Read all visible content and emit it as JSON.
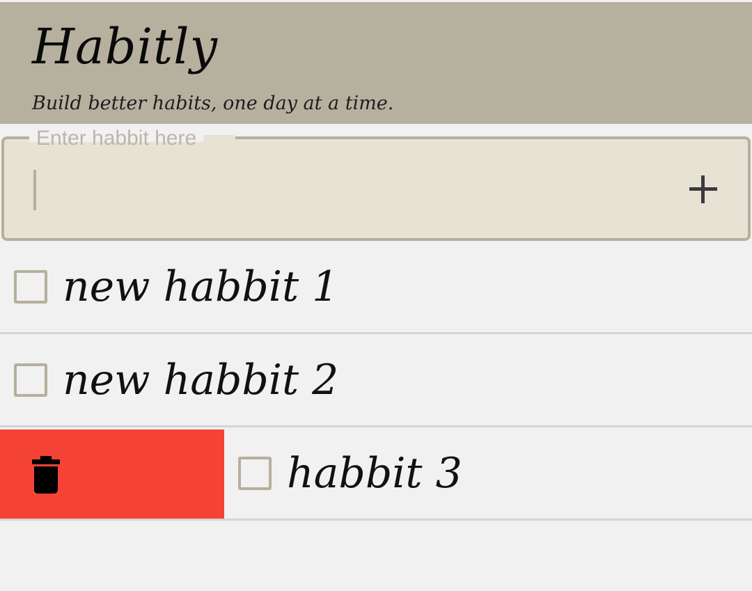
{
  "header": {
    "title": "Habitly",
    "subtitle": "Build better habits, one day at a time."
  },
  "input": {
    "label": "Enter habbit here",
    "value": "",
    "add_icon": "plus-icon"
  },
  "habits": [
    {
      "label": "new habbit 1",
      "checked": false,
      "swiped": false
    },
    {
      "label": "new habbit 2",
      "checked": false,
      "swiped": false
    },
    {
      "label": "habbit 3",
      "checked": false,
      "swiped": true
    }
  ],
  "delete_action": {
    "icon": "trash-icon",
    "color": "#f44336"
  },
  "colors": {
    "header_bg": "#b6b19f",
    "field_bg": "#e8e2d4",
    "accent": "#b5af9c",
    "page_bg": "#f1f1f1"
  }
}
